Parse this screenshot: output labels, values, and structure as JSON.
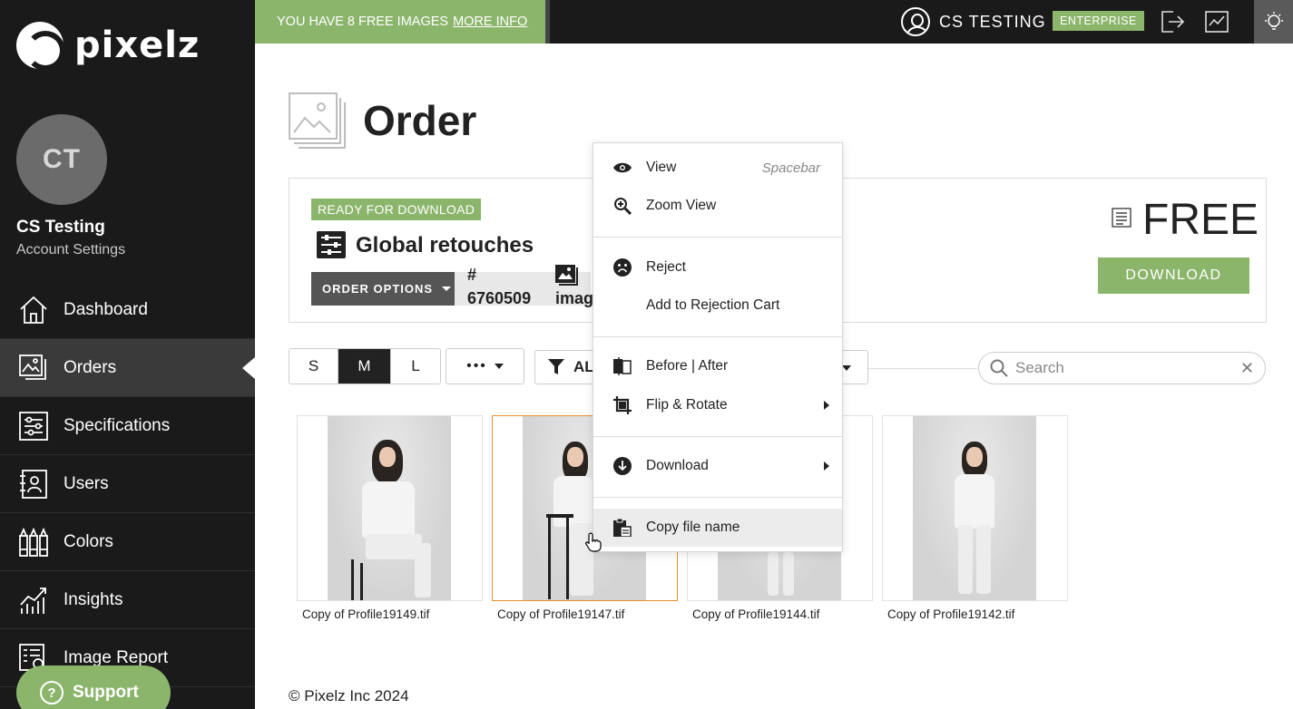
{
  "brand": {
    "name": "pixelz",
    "accent": "#8cb56c"
  },
  "topbar": {
    "promo_text": "YOU HAVE 8 FREE IMAGES",
    "promo_link": "MORE INFO",
    "user_label": "CS TESTING",
    "plan_badge": "ENTERPRISE",
    "icons": [
      "user-icon",
      "logout-icon",
      "chart-icon",
      "lightbulb-icon"
    ]
  },
  "sidebar": {
    "avatar_initials": "CT",
    "user_name": "CS Testing",
    "account_settings": "Account Settings",
    "items": [
      {
        "label": "Dashboard",
        "icon": "home-icon"
      },
      {
        "label": "Orders",
        "icon": "orders-icon",
        "active": true
      },
      {
        "label": "Specifications",
        "icon": "sliders-icon"
      },
      {
        "label": "Users",
        "icon": "users-icon"
      },
      {
        "label": "Colors",
        "icon": "colors-icon"
      },
      {
        "label": "Insights",
        "icon": "insights-icon"
      },
      {
        "label": "Image Report",
        "icon": "report-icon"
      }
    ],
    "support_label": "Support",
    "support_icon": "?"
  },
  "order": {
    "title": "Order",
    "status_badge": "READY FOR DOWNLOAD",
    "spec_name": "Global retouches",
    "options_label": "ORDER OPTIONS",
    "id_hash": "#",
    "id_number": "6760509",
    "images_label": "imag",
    "price": "FREE",
    "download_label": "DOWNLOAD"
  },
  "toolbar": {
    "sizes": [
      "S",
      "M",
      "L"
    ],
    "active_size": "M",
    "more_label": "•••",
    "filter_label": "AL",
    "search_placeholder": "Search",
    "search_clear": "✕"
  },
  "images": [
    {
      "filename": "Copy of Profile19149.tif",
      "selected": false
    },
    {
      "filename": "Copy of Profile19147.tif",
      "selected": true
    },
    {
      "filename": "Copy of Profile19144.tif",
      "selected": false
    },
    {
      "filename": "Copy of Profile19142.tif",
      "selected": false
    }
  ],
  "context_menu": {
    "view": "View",
    "view_shortcut": "Spacebar",
    "zoom_view": "Zoom View",
    "reject": "Reject",
    "add_rejection": "Add to Rejection Cart",
    "before_after": "Before | After",
    "flip_rotate": "Flip & Rotate",
    "download": "Download",
    "copy_file_name": "Copy file name"
  },
  "footer": {
    "copyright": "© Pixelz Inc 2024"
  }
}
